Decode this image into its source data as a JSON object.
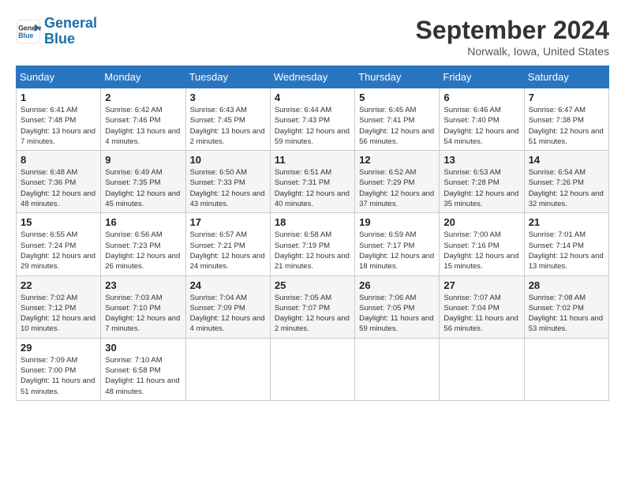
{
  "header": {
    "logo_line1": "General",
    "logo_line2": "Blue",
    "month_title": "September 2024",
    "location": "Norwalk, Iowa, United States"
  },
  "days_of_week": [
    "Sunday",
    "Monday",
    "Tuesday",
    "Wednesday",
    "Thursday",
    "Friday",
    "Saturday"
  ],
  "weeks": [
    [
      {
        "day": "1",
        "sunrise": "Sunrise: 6:41 AM",
        "sunset": "Sunset: 7:48 PM",
        "daylight": "Daylight: 13 hours and 7 minutes."
      },
      {
        "day": "2",
        "sunrise": "Sunrise: 6:42 AM",
        "sunset": "Sunset: 7:46 PM",
        "daylight": "Daylight: 13 hours and 4 minutes."
      },
      {
        "day": "3",
        "sunrise": "Sunrise: 6:43 AM",
        "sunset": "Sunset: 7:45 PM",
        "daylight": "Daylight: 13 hours and 2 minutes."
      },
      {
        "day": "4",
        "sunrise": "Sunrise: 6:44 AM",
        "sunset": "Sunset: 7:43 PM",
        "daylight": "Daylight: 12 hours and 59 minutes."
      },
      {
        "day": "5",
        "sunrise": "Sunrise: 6:45 AM",
        "sunset": "Sunset: 7:41 PM",
        "daylight": "Daylight: 12 hours and 56 minutes."
      },
      {
        "day": "6",
        "sunrise": "Sunrise: 6:46 AM",
        "sunset": "Sunset: 7:40 PM",
        "daylight": "Daylight: 12 hours and 54 minutes."
      },
      {
        "day": "7",
        "sunrise": "Sunrise: 6:47 AM",
        "sunset": "Sunset: 7:38 PM",
        "daylight": "Daylight: 12 hours and 51 minutes."
      }
    ],
    [
      {
        "day": "8",
        "sunrise": "Sunrise: 6:48 AM",
        "sunset": "Sunset: 7:36 PM",
        "daylight": "Daylight: 12 hours and 48 minutes."
      },
      {
        "day": "9",
        "sunrise": "Sunrise: 6:49 AM",
        "sunset": "Sunset: 7:35 PM",
        "daylight": "Daylight: 12 hours and 45 minutes."
      },
      {
        "day": "10",
        "sunrise": "Sunrise: 6:50 AM",
        "sunset": "Sunset: 7:33 PM",
        "daylight": "Daylight: 12 hours and 43 minutes."
      },
      {
        "day": "11",
        "sunrise": "Sunrise: 6:51 AM",
        "sunset": "Sunset: 7:31 PM",
        "daylight": "Daylight: 12 hours and 40 minutes."
      },
      {
        "day": "12",
        "sunrise": "Sunrise: 6:52 AM",
        "sunset": "Sunset: 7:29 PM",
        "daylight": "Daylight: 12 hours and 37 minutes."
      },
      {
        "day": "13",
        "sunrise": "Sunrise: 6:53 AM",
        "sunset": "Sunset: 7:28 PM",
        "daylight": "Daylight: 12 hours and 35 minutes."
      },
      {
        "day": "14",
        "sunrise": "Sunrise: 6:54 AM",
        "sunset": "Sunset: 7:26 PM",
        "daylight": "Daylight: 12 hours and 32 minutes."
      }
    ],
    [
      {
        "day": "15",
        "sunrise": "Sunrise: 6:55 AM",
        "sunset": "Sunset: 7:24 PM",
        "daylight": "Daylight: 12 hours and 29 minutes."
      },
      {
        "day": "16",
        "sunrise": "Sunrise: 6:56 AM",
        "sunset": "Sunset: 7:23 PM",
        "daylight": "Daylight: 12 hours and 26 minutes."
      },
      {
        "day": "17",
        "sunrise": "Sunrise: 6:57 AM",
        "sunset": "Sunset: 7:21 PM",
        "daylight": "Daylight: 12 hours and 24 minutes."
      },
      {
        "day": "18",
        "sunrise": "Sunrise: 6:58 AM",
        "sunset": "Sunset: 7:19 PM",
        "daylight": "Daylight: 12 hours and 21 minutes."
      },
      {
        "day": "19",
        "sunrise": "Sunrise: 6:59 AM",
        "sunset": "Sunset: 7:17 PM",
        "daylight": "Daylight: 12 hours and 18 minutes."
      },
      {
        "day": "20",
        "sunrise": "Sunrise: 7:00 AM",
        "sunset": "Sunset: 7:16 PM",
        "daylight": "Daylight: 12 hours and 15 minutes."
      },
      {
        "day": "21",
        "sunrise": "Sunrise: 7:01 AM",
        "sunset": "Sunset: 7:14 PM",
        "daylight": "Daylight: 12 hours and 13 minutes."
      }
    ],
    [
      {
        "day": "22",
        "sunrise": "Sunrise: 7:02 AM",
        "sunset": "Sunset: 7:12 PM",
        "daylight": "Daylight: 12 hours and 10 minutes."
      },
      {
        "day": "23",
        "sunrise": "Sunrise: 7:03 AM",
        "sunset": "Sunset: 7:10 PM",
        "daylight": "Daylight: 12 hours and 7 minutes."
      },
      {
        "day": "24",
        "sunrise": "Sunrise: 7:04 AM",
        "sunset": "Sunset: 7:09 PM",
        "daylight": "Daylight: 12 hours and 4 minutes."
      },
      {
        "day": "25",
        "sunrise": "Sunrise: 7:05 AM",
        "sunset": "Sunset: 7:07 PM",
        "daylight": "Daylight: 12 hours and 2 minutes."
      },
      {
        "day": "26",
        "sunrise": "Sunrise: 7:06 AM",
        "sunset": "Sunset: 7:05 PM",
        "daylight": "Daylight: 11 hours and 59 minutes."
      },
      {
        "day": "27",
        "sunrise": "Sunrise: 7:07 AM",
        "sunset": "Sunset: 7:04 PM",
        "daylight": "Daylight: 11 hours and 56 minutes."
      },
      {
        "day": "28",
        "sunrise": "Sunrise: 7:08 AM",
        "sunset": "Sunset: 7:02 PM",
        "daylight": "Daylight: 11 hours and 53 minutes."
      }
    ],
    [
      {
        "day": "29",
        "sunrise": "Sunrise: 7:09 AM",
        "sunset": "Sunset: 7:00 PM",
        "daylight": "Daylight: 11 hours and 51 minutes."
      },
      {
        "day": "30",
        "sunrise": "Sunrise: 7:10 AM",
        "sunset": "Sunset: 6:58 PM",
        "daylight": "Daylight: 11 hours and 48 minutes."
      },
      null,
      null,
      null,
      null,
      null
    ]
  ]
}
